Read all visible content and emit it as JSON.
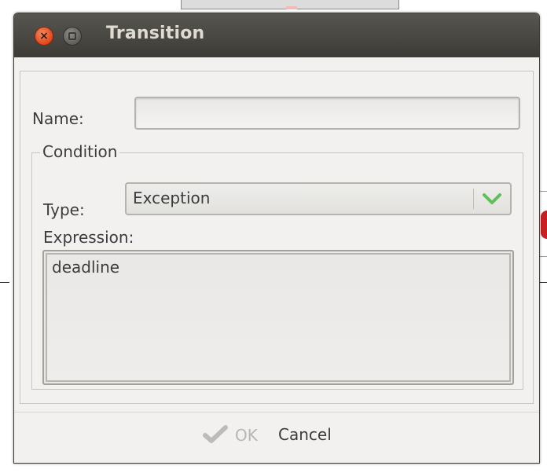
{
  "window": {
    "title": "Transition",
    "close_icon": "close-icon",
    "maximize_icon": "maximize-icon"
  },
  "form": {
    "name_label": "Name:",
    "name_value": "",
    "condition_legend": "Condition",
    "type_label": "Type:",
    "type_value": "Exception",
    "expression_label": "Expression:",
    "expression_value": "deadline"
  },
  "footer": {
    "ok_label": "OK",
    "ok_icon": "checkmark-icon",
    "cancel_label": "Cancel"
  },
  "colors": {
    "titlebar": "#3c3b37",
    "close_button": "#e2471c",
    "dropdown_chevron": "#5fbf5a",
    "disabled_text": "#b8b6b2"
  }
}
